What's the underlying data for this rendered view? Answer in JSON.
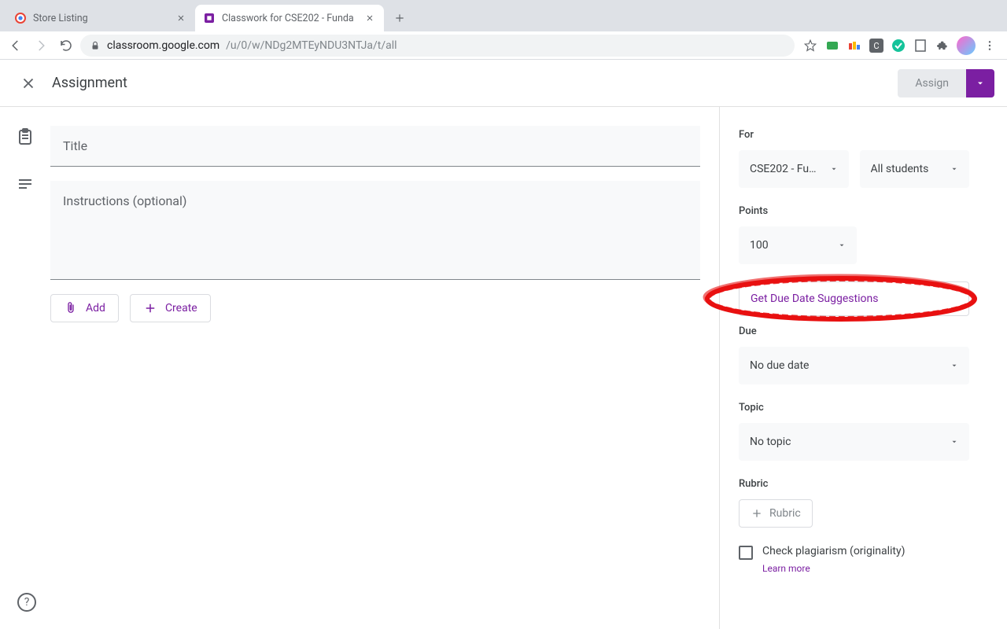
{
  "chrome": {
    "tabs": [
      {
        "title": "Store Listing",
        "active": false
      },
      {
        "title": "Classwork for CSE202 - Funda",
        "active": true
      }
    ],
    "url_host": "classroom.google.com",
    "url_path": "/u/0/w/NDg2MTEyNDU3NTJa/t/all"
  },
  "header": {
    "title": "Assignment",
    "assign_label": "Assign"
  },
  "center": {
    "title_placeholder": "Title",
    "instructions_placeholder": "Instructions (optional)",
    "add_label": "Add",
    "create_label": "Create"
  },
  "right": {
    "for_label": "For",
    "class_value": "CSE202 - Fu…",
    "students_value": "All students",
    "points_label": "Points",
    "points_value": "100",
    "suggestion_label": "Get Due Date Suggestions",
    "due_label": "Due",
    "due_value": "No due date",
    "topic_label": "Topic",
    "topic_value": "No topic",
    "rubric_label": "Rubric",
    "rubric_btn": "Rubric",
    "plagiarism_label": "Check plagiarism (originality)",
    "learn_more": "Learn more"
  },
  "help": "?"
}
